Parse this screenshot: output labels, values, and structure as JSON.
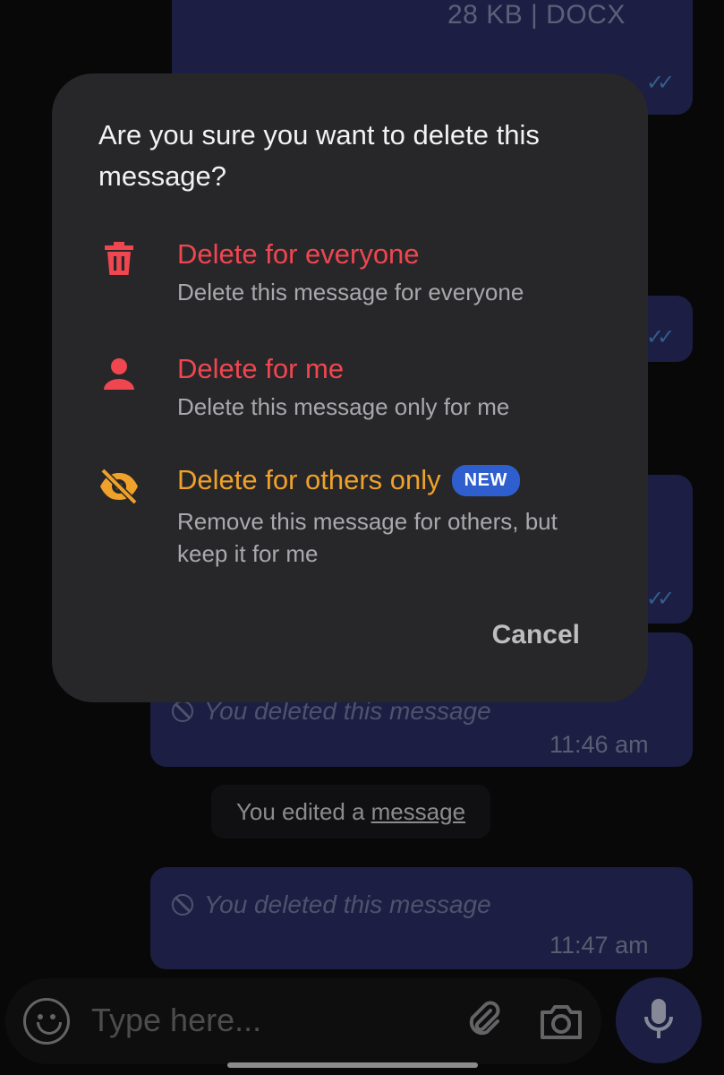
{
  "chat": {
    "file_meta": "28 KB | DOCX",
    "ticks": "✓✓",
    "messages": [
      {
        "text": "You deleted this message",
        "time": "11:46 am"
      },
      {
        "text": "You deleted this message",
        "time": "11:47 am"
      }
    ],
    "system_notice": {
      "prefix": "You edited a",
      "link": "message"
    }
  },
  "input_bar": {
    "placeholder": "Type here...",
    "icons": [
      "emoji-icon",
      "paperclip-icon",
      "camera-icon",
      "microphone-icon"
    ]
  },
  "dialog": {
    "title": "Are you sure you want to delete this message?",
    "options": [
      {
        "icon": "trash-icon",
        "title": "Delete for everyone",
        "desc": "Delete this message for everyone",
        "color": "#ef4650"
      },
      {
        "icon": "person-icon",
        "title": "Delete for me",
        "desc": "Delete this message only for me",
        "color": "#ef4650"
      },
      {
        "icon": "eye-off-icon",
        "title": "Delete for others only",
        "badge": "NEW",
        "desc": "Remove this message for others, but keep it for me",
        "color": "#f0a12a"
      }
    ],
    "cancel_label": "Cancel"
  },
  "colors": {
    "bubble": "#2b3168",
    "dialog_bg": "#272729",
    "danger": "#ef4650",
    "warning": "#f0a12a",
    "badge": "#2f5fcf"
  }
}
